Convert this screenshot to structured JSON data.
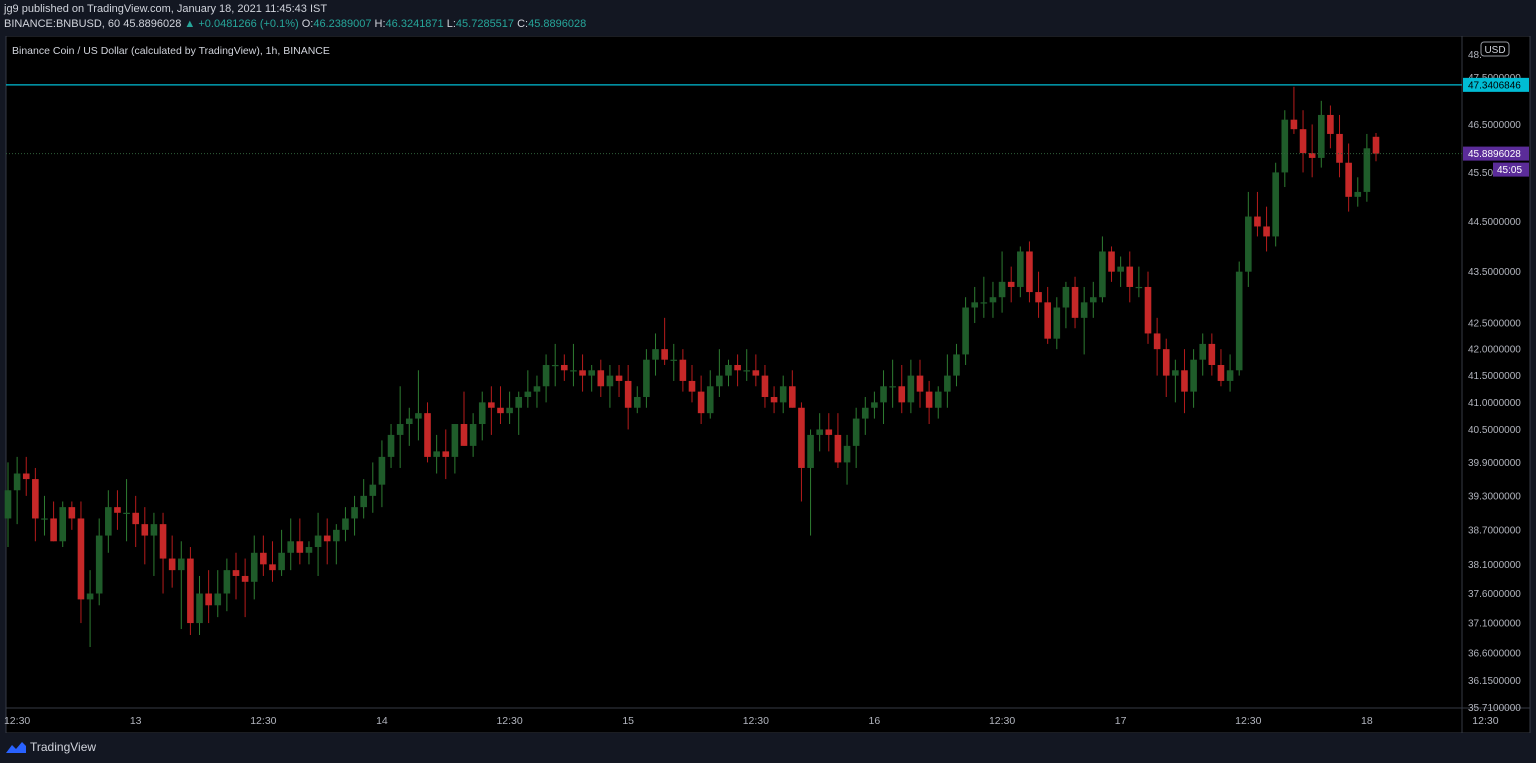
{
  "header": {
    "published": "jg9 published on TradingView.com, January 18, 2021 11:45:43 IST",
    "symbol_interval": "BINANCE:BNBUSD, 60",
    "last": "45.8896028",
    "change": "+0.0481266 (+0.1%)",
    "o_label": "O:",
    "o_value": "46.2389007",
    "h_label": "H:",
    "h_value": "46.3241871",
    "l_label": "L:",
    "l_value": "45.7285517",
    "c_label": "C:",
    "c_value": "45.8896028",
    "up_arrow_icon": "triangle-up-icon"
  },
  "footer": {
    "brand": "TradingView",
    "logo_icon": "tradingview-logo-icon"
  },
  "colors": {
    "background": "#000000",
    "up": "#26a69a",
    "up_candle": "#1f5c2a",
    "down": "#c62828",
    "line": "#00bcd4",
    "price_badge": "#5b2c99"
  },
  "chart_data": {
    "type": "candlestick",
    "title": "Binance Coin / US Dollar (calculated by TradingView), 1h, BINANCE",
    "currency": "USD",
    "y_scale": "log",
    "ylim": [
      35.7,
      48.4
    ],
    "y_ticks": [
      "48.",
      "47.5000000",
      "46.5000000",
      "45.50",
      "44.5000000",
      "43.5000000",
      "42.5000000",
      "42.0000000",
      "41.5000000",
      "41.0000000",
      "40.5000000",
      "39.9000000",
      "39.3000000",
      "38.7000000",
      "38.1000000",
      "37.6000000",
      "37.1000000",
      "36.6000000",
      "36.1500000",
      "35.7100000"
    ],
    "x_ticks": [
      "12:30",
      "13",
      "12:30",
      "14",
      "12:30",
      "15",
      "12:30",
      "16",
      "12:30",
      "17",
      "12:30",
      "18",
      "12:30"
    ],
    "horizontal_line": {
      "value": 47.3406846,
      "label": "47.3406846"
    },
    "last_price": {
      "value": 45.8896028,
      "label": "45.8896028",
      "countdown": "45:05"
    },
    "candles": [
      {
        "t": 0,
        "o": 38.9,
        "h": 39.9,
        "l": 38.4,
        "c": 39.4
      },
      {
        "t": 1,
        "o": 39.4,
        "h": 40.0,
        "l": 38.8,
        "c": 39.7
      },
      {
        "t": 2,
        "o": 39.7,
        "h": 40.0,
        "l": 39.3,
        "c": 39.6
      },
      {
        "t": 3,
        "o": 39.6,
        "h": 39.8,
        "l": 38.5,
        "c": 38.9
      },
      {
        "t": 4,
        "o": 38.9,
        "h": 39.3,
        "l": 38.6,
        "c": 38.9
      },
      {
        "t": 5,
        "o": 38.9,
        "h": 39.2,
        "l": 38.5,
        "c": 38.5
      },
      {
        "t": 6,
        "o": 38.5,
        "h": 39.2,
        "l": 38.4,
        "c": 39.1
      },
      {
        "t": 7,
        "o": 39.1,
        "h": 39.2,
        "l": 38.7,
        "c": 38.9
      },
      {
        "t": 8,
        "o": 38.9,
        "h": 39.2,
        "l": 37.1,
        "c": 37.5
      },
      {
        "t": 9,
        "o": 37.5,
        "h": 38.0,
        "l": 36.7,
        "c": 37.6
      },
      {
        "t": 10,
        "o": 37.6,
        "h": 38.9,
        "l": 37.4,
        "c": 38.6
      },
      {
        "t": 11,
        "o": 38.6,
        "h": 39.4,
        "l": 38.3,
        "c": 39.1
      },
      {
        "t": 12,
        "o": 39.1,
        "h": 39.4,
        "l": 38.7,
        "c": 39.0
      },
      {
        "t": 13,
        "o": 39.0,
        "h": 39.6,
        "l": 38.5,
        "c": 39.0
      },
      {
        "t": 14,
        "o": 39.0,
        "h": 39.3,
        "l": 38.4,
        "c": 38.8
      },
      {
        "t": 15,
        "o": 38.8,
        "h": 39.1,
        "l": 38.1,
        "c": 38.6
      },
      {
        "t": 16,
        "o": 38.6,
        "h": 39.0,
        "l": 37.9,
        "c": 38.8
      },
      {
        "t": 17,
        "o": 38.8,
        "h": 39.0,
        "l": 37.6,
        "c": 38.2
      },
      {
        "t": 18,
        "o": 38.2,
        "h": 38.6,
        "l": 37.7,
        "c": 38.0
      },
      {
        "t": 19,
        "o": 38.0,
        "h": 38.5,
        "l": 37.0,
        "c": 38.2
      },
      {
        "t": 20,
        "o": 38.2,
        "h": 38.4,
        "l": 36.9,
        "c": 37.1
      },
      {
        "t": 21,
        "o": 37.1,
        "h": 37.9,
        "l": 36.9,
        "c": 37.6
      },
      {
        "t": 22,
        "o": 37.6,
        "h": 38.0,
        "l": 37.1,
        "c": 37.4
      },
      {
        "t": 23,
        "o": 37.4,
        "h": 38.0,
        "l": 37.2,
        "c": 37.6
      },
      {
        "t": 24,
        "o": 37.6,
        "h": 38.2,
        "l": 37.3,
        "c": 38.0
      },
      {
        "t": 25,
        "o": 38.0,
        "h": 38.3,
        "l": 37.5,
        "c": 37.9
      },
      {
        "t": 26,
        "o": 37.9,
        "h": 38.2,
        "l": 37.2,
        "c": 37.8
      },
      {
        "t": 27,
        "o": 37.8,
        "h": 38.6,
        "l": 37.5,
        "c": 38.3
      },
      {
        "t": 28,
        "o": 38.3,
        "h": 38.6,
        "l": 37.9,
        "c": 38.1
      },
      {
        "t": 29,
        "o": 38.1,
        "h": 38.5,
        "l": 37.8,
        "c": 38.0
      },
      {
        "t": 30,
        "o": 38.0,
        "h": 38.7,
        "l": 37.9,
        "c": 38.3
      },
      {
        "t": 31,
        "o": 38.3,
        "h": 38.9,
        "l": 38.0,
        "c": 38.5
      },
      {
        "t": 32,
        "o": 38.5,
        "h": 38.9,
        "l": 38.1,
        "c": 38.3
      },
      {
        "t": 33,
        "o": 38.3,
        "h": 38.5,
        "l": 38.1,
        "c": 38.4
      },
      {
        "t": 34,
        "o": 38.4,
        "h": 39.0,
        "l": 37.9,
        "c": 38.6
      },
      {
        "t": 35,
        "o": 38.6,
        "h": 38.9,
        "l": 38.1,
        "c": 38.5
      },
      {
        "t": 36,
        "o": 38.5,
        "h": 38.8,
        "l": 38.1,
        "c": 38.7
      },
      {
        "t": 37,
        "o": 38.7,
        "h": 39.1,
        "l": 38.5,
        "c": 38.9
      },
      {
        "t": 38,
        "o": 38.9,
        "h": 39.3,
        "l": 38.6,
        "c": 39.1
      },
      {
        "t": 39,
        "o": 39.1,
        "h": 39.6,
        "l": 38.9,
        "c": 39.3
      },
      {
        "t": 40,
        "o": 39.3,
        "h": 39.9,
        "l": 39.0,
        "c": 39.5
      },
      {
        "t": 41,
        "o": 39.5,
        "h": 40.3,
        "l": 39.1,
        "c": 40.0
      },
      {
        "t": 42,
        "o": 40.0,
        "h": 40.6,
        "l": 39.8,
        "c": 40.4
      },
      {
        "t": 43,
        "o": 40.4,
        "h": 41.3,
        "l": 39.8,
        "c": 40.6
      },
      {
        "t": 44,
        "o": 40.6,
        "h": 40.9,
        "l": 40.2,
        "c": 40.7
      },
      {
        "t": 45,
        "o": 40.7,
        "h": 41.6,
        "l": 40.3,
        "c": 40.8
      },
      {
        "t": 46,
        "o": 40.8,
        "h": 41.0,
        "l": 39.9,
        "c": 40.0
      },
      {
        "t": 47,
        "o": 40.0,
        "h": 40.4,
        "l": 39.7,
        "c": 40.1
      },
      {
        "t": 48,
        "o": 40.1,
        "h": 40.5,
        "l": 39.6,
        "c": 40.0
      },
      {
        "t": 49,
        "o": 40.0,
        "h": 40.6,
        "l": 39.7,
        "c": 40.6
      },
      {
        "t": 50,
        "o": 40.6,
        "h": 41.2,
        "l": 40.2,
        "c": 40.2
      },
      {
        "t": 51,
        "o": 40.2,
        "h": 40.8,
        "l": 40.0,
        "c": 40.6
      },
      {
        "t": 52,
        "o": 40.6,
        "h": 41.2,
        "l": 40.3,
        "c": 41.0
      },
      {
        "t": 53,
        "o": 41.0,
        "h": 41.3,
        "l": 40.4,
        "c": 40.9
      },
      {
        "t": 54,
        "o": 40.9,
        "h": 41.3,
        "l": 40.6,
        "c": 40.8
      },
      {
        "t": 55,
        "o": 40.8,
        "h": 41.2,
        "l": 40.6,
        "c": 40.9
      },
      {
        "t": 56,
        "o": 40.9,
        "h": 41.2,
        "l": 40.4,
        "c": 41.1
      },
      {
        "t": 57,
        "o": 41.1,
        "h": 41.6,
        "l": 40.9,
        "c": 41.2
      },
      {
        "t": 58,
        "o": 41.2,
        "h": 41.5,
        "l": 40.9,
        "c": 41.3
      },
      {
        "t": 59,
        "o": 41.3,
        "h": 41.9,
        "l": 41.0,
        "c": 41.7
      },
      {
        "t": 60,
        "o": 41.7,
        "h": 42.1,
        "l": 41.3,
        "c": 41.7
      },
      {
        "t": 61,
        "o": 41.7,
        "h": 41.9,
        "l": 41.4,
        "c": 41.6
      },
      {
        "t": 62,
        "o": 41.6,
        "h": 42.1,
        "l": 41.3,
        "c": 41.6
      },
      {
        "t": 63,
        "o": 41.6,
        "h": 41.9,
        "l": 41.2,
        "c": 41.5
      },
      {
        "t": 64,
        "o": 41.5,
        "h": 41.7,
        "l": 41.2,
        "c": 41.6
      },
      {
        "t": 65,
        "o": 41.6,
        "h": 41.8,
        "l": 41.1,
        "c": 41.3
      },
      {
        "t": 66,
        "o": 41.3,
        "h": 41.7,
        "l": 40.9,
        "c": 41.5
      },
      {
        "t": 67,
        "o": 41.5,
        "h": 41.7,
        "l": 41.1,
        "c": 41.4
      },
      {
        "t": 68,
        "o": 41.4,
        "h": 41.7,
        "l": 40.5,
        "c": 40.9
      },
      {
        "t": 69,
        "o": 40.9,
        "h": 41.3,
        "l": 40.8,
        "c": 41.1
      },
      {
        "t": 70,
        "o": 41.1,
        "h": 42.0,
        "l": 40.9,
        "c": 41.8
      },
      {
        "t": 71,
        "o": 41.8,
        "h": 42.3,
        "l": 41.5,
        "c": 42.0
      },
      {
        "t": 72,
        "o": 42.0,
        "h": 42.6,
        "l": 41.7,
        "c": 41.8
      },
      {
        "t": 73,
        "o": 41.8,
        "h": 42.1,
        "l": 41.4,
        "c": 41.8
      },
      {
        "t": 74,
        "o": 41.8,
        "h": 42.0,
        "l": 41.2,
        "c": 41.4
      },
      {
        "t": 75,
        "o": 41.4,
        "h": 41.7,
        "l": 41.0,
        "c": 41.2
      },
      {
        "t": 76,
        "o": 41.2,
        "h": 41.5,
        "l": 40.6,
        "c": 40.8
      },
      {
        "t": 77,
        "o": 40.8,
        "h": 41.6,
        "l": 40.7,
        "c": 41.3
      },
      {
        "t": 78,
        "o": 41.3,
        "h": 42.0,
        "l": 41.1,
        "c": 41.5
      },
      {
        "t": 79,
        "o": 41.5,
        "h": 41.8,
        "l": 41.3,
        "c": 41.7
      },
      {
        "t": 80,
        "o": 41.7,
        "h": 41.9,
        "l": 41.3,
        "c": 41.6
      },
      {
        "t": 81,
        "o": 41.6,
        "h": 42.0,
        "l": 41.4,
        "c": 41.6
      },
      {
        "t": 82,
        "o": 41.6,
        "h": 41.9,
        "l": 41.3,
        "c": 41.5
      },
      {
        "t": 83,
        "o": 41.5,
        "h": 41.7,
        "l": 40.9,
        "c": 41.1
      },
      {
        "t": 84,
        "o": 41.1,
        "h": 41.3,
        "l": 40.8,
        "c": 41.0
      },
      {
        "t": 85,
        "o": 41.0,
        "h": 41.5,
        "l": 40.8,
        "c": 41.3
      },
      {
        "t": 86,
        "o": 41.3,
        "h": 41.6,
        "l": 40.9,
        "c": 40.9
      },
      {
        "t": 87,
        "o": 40.9,
        "h": 41.0,
        "l": 39.2,
        "c": 39.8
      },
      {
        "t": 88,
        "o": 39.8,
        "h": 40.5,
        "l": 38.6,
        "c": 40.4
      },
      {
        "t": 89,
        "o": 40.4,
        "h": 40.8,
        "l": 40.1,
        "c": 40.5
      },
      {
        "t": 90,
        "o": 40.5,
        "h": 40.8,
        "l": 40.1,
        "c": 40.4
      },
      {
        "t": 91,
        "o": 40.4,
        "h": 40.8,
        "l": 39.8,
        "c": 39.9
      },
      {
        "t": 92,
        "o": 39.9,
        "h": 40.4,
        "l": 39.5,
        "c": 40.2
      },
      {
        "t": 93,
        "o": 40.2,
        "h": 40.9,
        "l": 39.8,
        "c": 40.7
      },
      {
        "t": 94,
        "o": 40.7,
        "h": 41.1,
        "l": 40.4,
        "c": 40.9
      },
      {
        "t": 95,
        "o": 40.9,
        "h": 41.2,
        "l": 40.7,
        "c": 41.0
      },
      {
        "t": 96,
        "o": 41.0,
        "h": 41.6,
        "l": 40.6,
        "c": 41.3
      },
      {
        "t": 97,
        "o": 41.3,
        "h": 41.8,
        "l": 40.9,
        "c": 41.3
      },
      {
        "t": 98,
        "o": 41.3,
        "h": 41.7,
        "l": 40.8,
        "c": 41.0
      },
      {
        "t": 99,
        "o": 41.0,
        "h": 41.8,
        "l": 40.8,
        "c": 41.5
      },
      {
        "t": 100,
        "o": 41.5,
        "h": 41.8,
        "l": 40.9,
        "c": 41.2
      },
      {
        "t": 101,
        "o": 41.2,
        "h": 41.4,
        "l": 40.6,
        "c": 40.9
      },
      {
        "t": 102,
        "o": 40.9,
        "h": 41.3,
        "l": 40.7,
        "c": 41.2
      },
      {
        "t": 103,
        "o": 41.2,
        "h": 41.9,
        "l": 40.9,
        "c": 41.5
      },
      {
        "t": 104,
        "o": 41.5,
        "h": 42.1,
        "l": 41.3,
        "c": 41.9
      },
      {
        "t": 105,
        "o": 41.9,
        "h": 43.0,
        "l": 41.7,
        "c": 42.8
      },
      {
        "t": 106,
        "o": 42.8,
        "h": 43.2,
        "l": 42.5,
        "c": 42.9
      },
      {
        "t": 107,
        "o": 42.9,
        "h": 43.4,
        "l": 42.6,
        "c": 42.9
      },
      {
        "t": 108,
        "o": 42.9,
        "h": 43.3,
        "l": 42.6,
        "c": 43.0
      },
      {
        "t": 109,
        "o": 43.0,
        "h": 43.9,
        "l": 42.7,
        "c": 43.3
      },
      {
        "t": 110,
        "o": 43.3,
        "h": 43.6,
        "l": 42.9,
        "c": 43.2
      },
      {
        "t": 111,
        "o": 43.2,
        "h": 44.0,
        "l": 43.0,
        "c": 43.9
      },
      {
        "t": 112,
        "o": 43.9,
        "h": 44.1,
        "l": 42.9,
        "c": 43.1
      },
      {
        "t": 113,
        "o": 43.1,
        "h": 43.5,
        "l": 42.6,
        "c": 42.9
      },
      {
        "t": 114,
        "o": 42.9,
        "h": 43.2,
        "l": 42.1,
        "c": 42.2
      },
      {
        "t": 115,
        "o": 42.2,
        "h": 43.0,
        "l": 42.0,
        "c": 42.8
      },
      {
        "t": 116,
        "o": 42.8,
        "h": 43.3,
        "l": 42.4,
        "c": 43.2
      },
      {
        "t": 117,
        "o": 43.2,
        "h": 43.4,
        "l": 42.4,
        "c": 42.6
      },
      {
        "t": 118,
        "o": 42.6,
        "h": 43.2,
        "l": 41.9,
        "c": 42.9
      },
      {
        "t": 119,
        "o": 42.9,
        "h": 43.3,
        "l": 42.6,
        "c": 43.0
      },
      {
        "t": 120,
        "o": 43.0,
        "h": 44.2,
        "l": 42.9,
        "c": 43.9
      },
      {
        "t": 121,
        "o": 43.9,
        "h": 44.0,
        "l": 43.3,
        "c": 43.5
      },
      {
        "t": 122,
        "o": 43.5,
        "h": 43.8,
        "l": 43.2,
        "c": 43.6
      },
      {
        "t": 123,
        "o": 43.6,
        "h": 43.9,
        "l": 42.9,
        "c": 43.2
      },
      {
        "t": 124,
        "o": 43.2,
        "h": 43.6,
        "l": 43.0,
        "c": 43.2
      },
      {
        "t": 125,
        "o": 43.2,
        "h": 43.5,
        "l": 42.1,
        "c": 42.3
      },
      {
        "t": 126,
        "o": 42.3,
        "h": 42.6,
        "l": 41.5,
        "c": 42.0
      },
      {
        "t": 127,
        "o": 42.0,
        "h": 42.2,
        "l": 41.1,
        "c": 41.5
      },
      {
        "t": 128,
        "o": 41.5,
        "h": 41.8,
        "l": 41.0,
        "c": 41.6
      },
      {
        "t": 129,
        "o": 41.6,
        "h": 42.0,
        "l": 40.8,
        "c": 41.2
      },
      {
        "t": 130,
        "o": 41.2,
        "h": 42.0,
        "l": 40.9,
        "c": 41.8
      },
      {
        "t": 131,
        "o": 41.8,
        "h": 42.3,
        "l": 41.5,
        "c": 42.1
      },
      {
        "t": 132,
        "o": 42.1,
        "h": 42.3,
        "l": 41.5,
        "c": 41.7
      },
      {
        "t": 133,
        "o": 41.7,
        "h": 42.0,
        "l": 41.3,
        "c": 41.4
      },
      {
        "t": 134,
        "o": 41.4,
        "h": 41.9,
        "l": 41.2,
        "c": 41.6
      },
      {
        "t": 135,
        "o": 41.6,
        "h": 43.7,
        "l": 41.5,
        "c": 43.5
      },
      {
        "t": 136,
        "o": 43.5,
        "h": 45.1,
        "l": 43.2,
        "c": 44.6
      },
      {
        "t": 137,
        "o": 44.6,
        "h": 45.1,
        "l": 44.2,
        "c": 44.4
      },
      {
        "t": 138,
        "o": 44.4,
        "h": 44.8,
        "l": 43.9,
        "c": 44.2
      },
      {
        "t": 139,
        "o": 44.2,
        "h": 45.7,
        "l": 44.0,
        "c": 45.5
      },
      {
        "t": 140,
        "o": 45.5,
        "h": 46.8,
        "l": 45.2,
        "c": 46.6
      },
      {
        "t": 141,
        "o": 46.6,
        "h": 47.3,
        "l": 46.3,
        "c": 46.4
      },
      {
        "t": 142,
        "o": 46.4,
        "h": 46.8,
        "l": 45.5,
        "c": 45.9
      },
      {
        "t": 143,
        "o": 45.9,
        "h": 46.5,
        "l": 45.4,
        "c": 45.8
      },
      {
        "t": 144,
        "o": 45.8,
        "h": 47.0,
        "l": 45.6,
        "c": 46.7
      },
      {
        "t": 145,
        "o": 46.7,
        "h": 46.9,
        "l": 46.0,
        "c": 46.3
      },
      {
        "t": 146,
        "o": 46.3,
        "h": 46.7,
        "l": 45.4,
        "c": 45.7
      },
      {
        "t": 147,
        "o": 45.7,
        "h": 46.1,
        "l": 44.7,
        "c": 45.0
      },
      {
        "t": 148,
        "o": 45.0,
        "h": 45.4,
        "l": 44.8,
        "c": 45.1
      },
      {
        "t": 149,
        "o": 45.1,
        "h": 46.3,
        "l": 44.9,
        "c": 46.0
      },
      {
        "t": 150,
        "o": 46.24,
        "h": 46.32,
        "l": 45.73,
        "c": 45.89
      }
    ],
    "x_tick_candle_index": [
      1,
      14,
      28,
      41,
      55,
      68,
      82,
      95,
      109,
      122,
      136,
      149,
      162
    ]
  }
}
